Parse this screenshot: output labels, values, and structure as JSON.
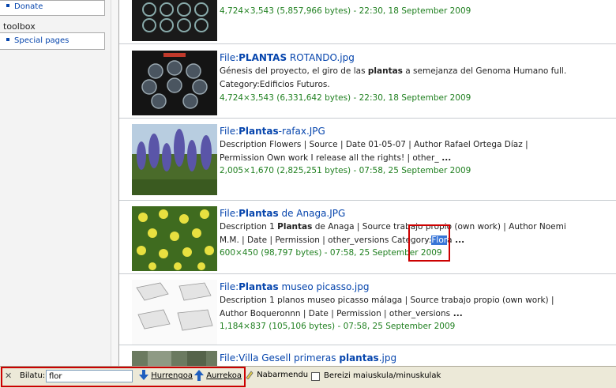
{
  "sidebar": {
    "donate_label": "Donate",
    "toolbox_title": "toolbox",
    "special_pages_label": "Special pages"
  },
  "results": [
    {
      "meta": "4,724×3,543 (5,857,966 bytes) - 22:30, 18 September 2009"
    },
    {
      "title_prefix": "File:",
      "title_bold": "PLANTAS",
      "title_rest": " ROTANDO.jpg",
      "desc_line1_a": "Génesis del proyecto, el giro de las ",
      "desc_line1_bold": "plantas",
      "desc_line1_b": " a semejanza del Genoma Humano full.",
      "desc_line2": "Category:Edificios Futuros.",
      "meta": "4,724×3,543 (6,331,642 bytes) - 22:30, 18 September 2009"
    },
    {
      "title_prefix": "File:",
      "title_bold": "Plantas",
      "title_rest": "-rafax.JPG",
      "desc_line1": "Description Flowers | Source | Date 01-05-07 | Author Rafael Ortega Díaz |",
      "desc_line2": "Permission Own work I release all the rights! | other_",
      "ellipsis": " ...",
      "meta": "2,005×1,670 (2,825,251 bytes) - 07:58, 25 September 2009"
    },
    {
      "title_prefix": "File:",
      "title_bold": "Plantas",
      "title_rest": " de Anaga.JPG",
      "desc_line1_a": "Description 1 ",
      "desc_line1_bold": "Plantas",
      "desc_line1_b": " de Anaga | Source trabajo propio (own work) | Author Noemi",
      "desc_line2_a": "M.M. | Date | Permission | other_versions Category:",
      "desc_line2_hl": "Flor",
      "desc_line2_b": "a",
      "ellipsis": " ...",
      "meta": "600×450 (98,797 bytes) - 07:58, 25 September 2009"
    },
    {
      "title_prefix": "File:",
      "title_bold": "Plantas",
      "title_rest": " museo picasso.jpg",
      "desc_line1": "Description 1 planos museo picasso málaga | Source trabajo propio (own work) |",
      "desc_line2": "Author Boqueronnn | Date | Permission | other_versions",
      "ellipsis": " ...",
      "meta": "1,184×837 (105,106 bytes) - 07:58, 25 September 2009"
    },
    {
      "title_prefix": "File:",
      "title_rest": "Villa Gesell primeras ",
      "title_bold": "plantas",
      "title_suffix": ".jpg"
    }
  ],
  "findbar": {
    "close_glyph": "✕",
    "label": "Bilatu:",
    "value": "flor",
    "next_label": "Hurrengoa",
    "prev_label": "Aurrekoa",
    "highlight_label": "Nabarmendu",
    "match_case_label": "Bereizi maiuskula/minuskulak"
  },
  "colors": {
    "link": "#0645ad",
    "meta_green": "#208020",
    "highlight": "#3875d7",
    "annotation_red": "#cc0000"
  }
}
